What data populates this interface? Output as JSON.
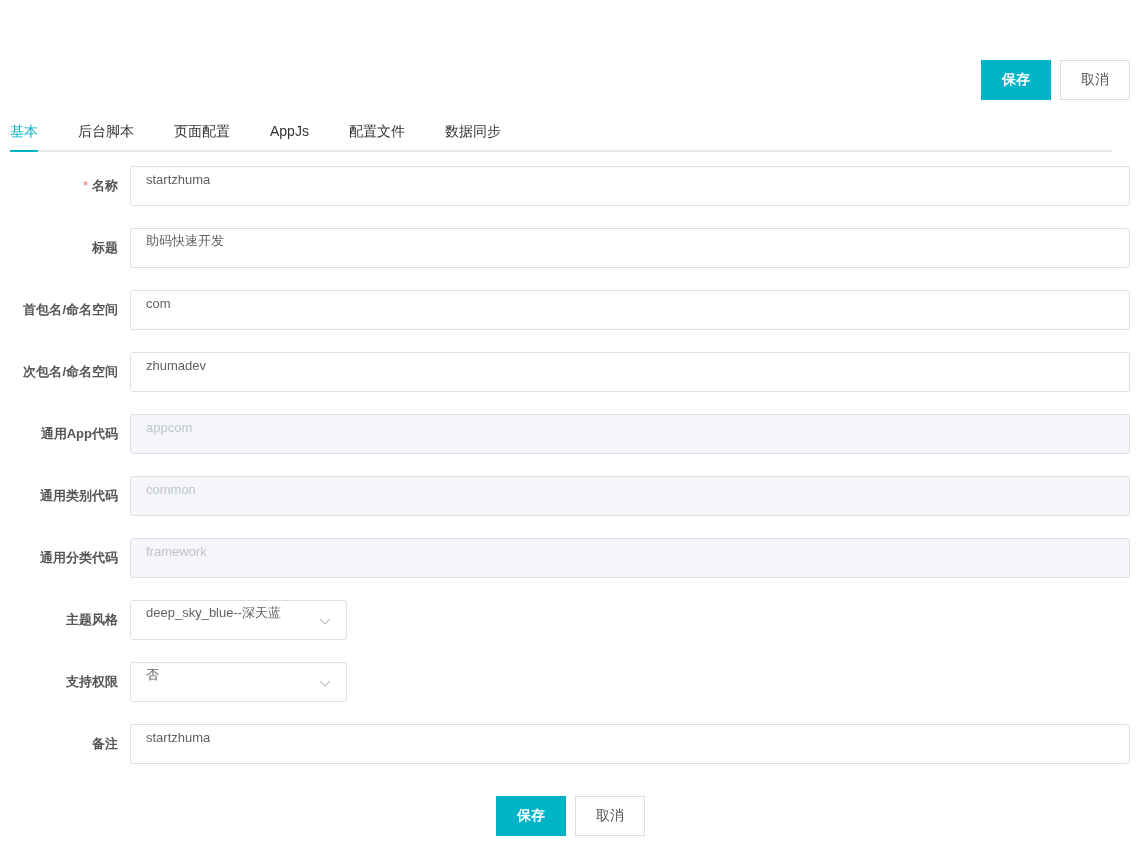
{
  "top_actions": [
    {
      "label": "保存",
      "kind": "primary"
    },
    {
      "label": "取消",
      "kind": "default"
    }
  ],
  "tabs": [
    {
      "label": "基本",
      "selected": true
    },
    {
      "label": "后台脚本",
      "selected": false
    },
    {
      "label": "页面配置",
      "selected": false
    },
    {
      "label": "AppJs",
      "selected": false
    },
    {
      "label": "配置文件",
      "selected": false
    },
    {
      "label": "数据同步",
      "selected": false
    }
  ],
  "fields": [
    {
      "kind": "text",
      "label": "名称",
      "required_mark": "*",
      "value": "startzhuma",
      "disabled": false
    },
    {
      "kind": "text",
      "label": "标题",
      "value": "助码快速开发",
      "disabled": false
    },
    {
      "kind": "text",
      "label": "首包名/命名空间",
      "value": "com",
      "disabled": false
    },
    {
      "kind": "text",
      "label": "次包名/命名空间",
      "value": "zhumadev",
      "disabled": false
    },
    {
      "kind": "text",
      "label": "通用App代码",
      "value": "appcom",
      "disabled": true
    },
    {
      "kind": "text",
      "label": "通用类别代码",
      "value": "common",
      "disabled": true
    },
    {
      "kind": "text",
      "label": "通用分类代码",
      "value": "framework",
      "disabled": true
    },
    {
      "kind": "select",
      "label": "主题风格",
      "value": "deep_sky_blue--深天蓝",
      "disabled": false
    },
    {
      "kind": "select",
      "label": "支持权限",
      "value": "否",
      "disabled": false
    },
    {
      "kind": "text",
      "label": "备注",
      "value": "startzhuma",
      "disabled": false
    }
  ],
  "bottom_actions": [
    {
      "label": "保存",
      "kind": "primary"
    },
    {
      "label": "取消",
      "kind": "default"
    }
  ]
}
